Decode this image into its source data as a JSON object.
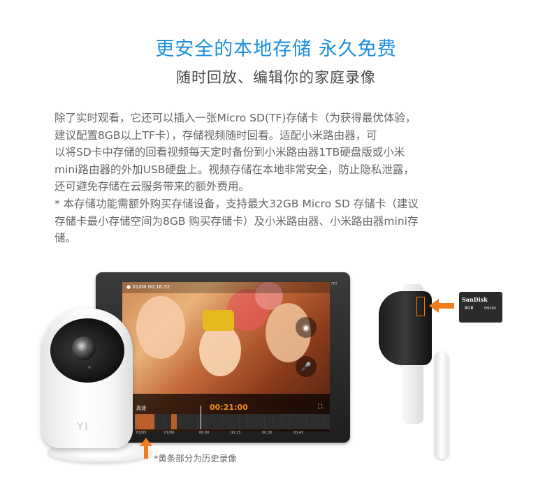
{
  "headline": "更安全的本地存储 永久免费",
  "subheadline": "随时回放、编辑你的家庭录像",
  "body_lines": [
    "除了实时观看，它还可以插入一张Micro SD(TF)存储卡（为获得最优体验，",
    "建议配置8GB以上TF卡），存储视频随时回看。适配小米路由器，可",
    "以将SD卡中存储的回看视频每天定时备份到小米路由器1TB硬盘版或小米",
    "mini路由器的外加USB硬盘上。视频存储在本地非常安全，防止隐私泄露，",
    "还可避免存储在云服务带来的额外费用。",
    "* 本存储功能需额外购买存储设备，支持最大32GB Micro SD 存储卡（建议",
    "存储卡最小存储空间为8GB 购买存储卡）及小米路由器、小米路由器mini存",
    "储。"
  ],
  "player": {
    "rec_label": "● 01/06 00:16:32",
    "hd_label": "高清",
    "current_time": "00:21:00",
    "tick_labels": [
      "01/05",
      "01/06",
      "00:00",
      "00:15",
      "00:30",
      "00:45",
      "01:00"
    ],
    "camera_icon": "camera-icon",
    "mic_icon": "microphone-icon",
    "fullscreen_icon": "fullscreen-icon",
    "tablet_logo": "mi"
  },
  "camera_brand": "YI",
  "sdcard": {
    "brand": "SanDisk",
    "capacity": "8GB",
    "class": "micro"
  },
  "note": "*黄条部分为历史录像",
  "colors": {
    "headline": "#1a8ee0",
    "accent_orange": "#f07c1c"
  }
}
